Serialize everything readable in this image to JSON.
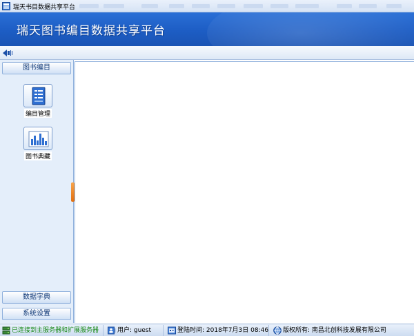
{
  "window": {
    "title": "瑞天书目数据共享平台"
  },
  "banner": {
    "title": "瑞天图书编目数据共享平台"
  },
  "sidebar": {
    "top_panel": "图书编目",
    "tiles": [
      {
        "label": "编目管理",
        "icon": "catalog-document-icon"
      },
      {
        "label": "图书典藏",
        "icon": "holdings-bars-icon"
      }
    ],
    "bottom_panels": [
      "数据字典",
      "系统设置"
    ]
  },
  "statusbar": {
    "connection": "已连接到主服务器和扩展服务器",
    "user": "用户: guest",
    "login_time": "登陆时间: 2018年7月3日 08:46",
    "copyright": "版权所有: 南昌北创科技发展有限公司"
  },
  "colors": {
    "banner_blue": "#1d5dc4",
    "sidebar_bg": "#e4eefa",
    "splitter_orange": "#f08a24",
    "connected_green": "#1a8a1a"
  }
}
